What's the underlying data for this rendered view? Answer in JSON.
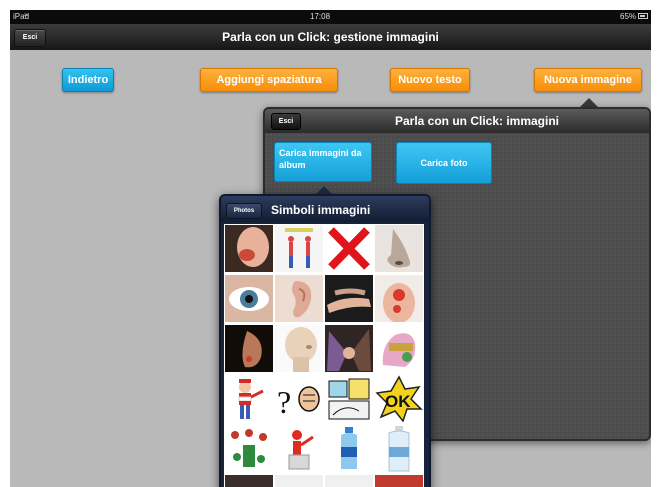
{
  "status_bar": {
    "device": "iPad",
    "time": "17:08",
    "battery": "65%"
  },
  "main_nav": {
    "title": "Parla con un Click: gestione immagini",
    "esci_label": "Esci"
  },
  "toolbar": {
    "indietro_label": "Indietro",
    "aggiungi_label": "Aggiungi spaziatura",
    "nuovo_testo_label": "Nuovo testo",
    "nuova_immagine_label": "Nuova immagine"
  },
  "images_popover": {
    "title": "Parla con un Click: immagini",
    "esci_label": "Esci",
    "carica_album_label": "Carica immagini da album",
    "carica_foto_label": "Carica foto"
  },
  "symbols_popover": {
    "title": "Simboli immagini",
    "photos_label": "Photos",
    "thumbnails": [
      "neck-pain",
      "human-anatomy-figures",
      "red-x",
      "nose",
      "eye",
      "ear",
      "hand",
      "back-pain",
      "chin",
      "head-sculpture",
      "holding-hands",
      "hand-tattoo",
      "waldo-figure",
      "question-fist",
      "comic-panel",
      "ok-sign",
      "chess-figures",
      "red-figure-podium",
      "water-bottle-small",
      "water-bottle-large"
    ]
  },
  "colors": {
    "blue_button": "#1aa3dc",
    "orange_button": "#f7940f",
    "nav_bar": "#1a1a1a"
  }
}
